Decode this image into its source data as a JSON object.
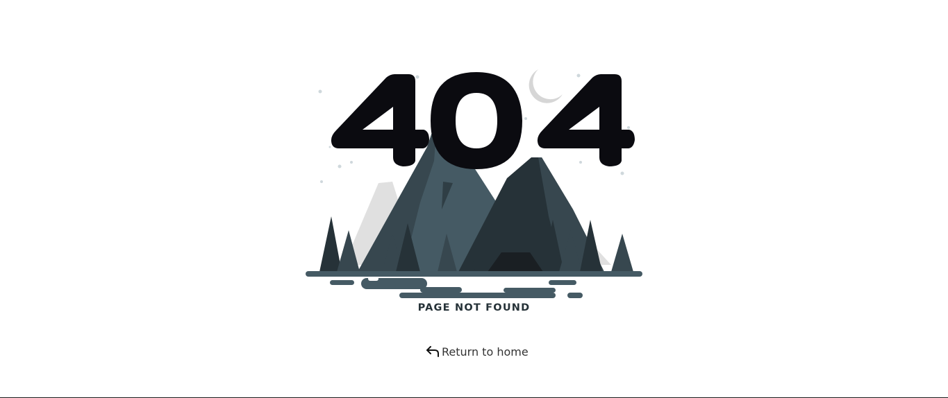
{
  "error": {
    "code_text": "404",
    "caption": "PAGE NOT FOUND"
  },
  "navigation": {
    "return_label": "Return to home",
    "return_icon": "arrow-return-left-icon"
  },
  "colors": {
    "background": "#ffffff",
    "digits": "#0b0b10",
    "mountain_light": "#455a64",
    "mountain_dark": "#263238",
    "snow": "#e0e0e0",
    "text": "#333333"
  }
}
